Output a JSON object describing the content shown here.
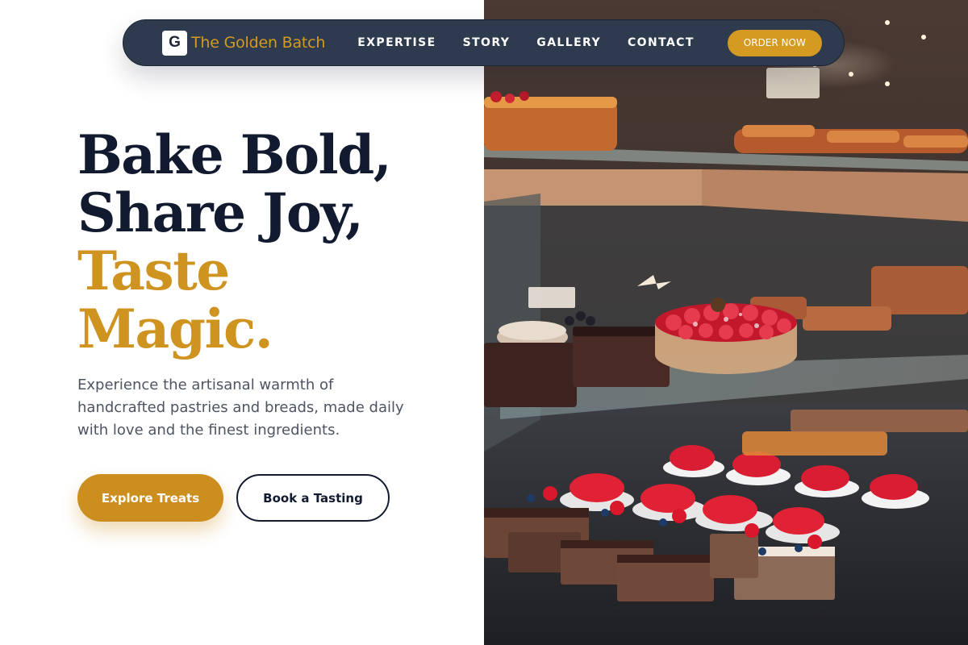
{
  "brand": {
    "mark": "G",
    "name": "The Golden Batch"
  },
  "nav": {
    "links": [
      "EXPERTISE",
      "STORY",
      "GALLERY",
      "CONTACT"
    ],
    "cta": "ORDER NOW"
  },
  "hero": {
    "title_lines": [
      "Bake Bold,",
      "Share Joy,"
    ],
    "title_accent_lines": [
      "Taste",
      "Magic."
    ],
    "description": "Experience the artisanal warmth of handcrafted pastries and breads, made daily with love and the finest ingredients.",
    "primary_button": "Explore Treats",
    "secondary_button": "Book a Tasting"
  },
  "image": {
    "subject": "bakery-display-case"
  },
  "colors": {
    "navy": "#111a2e",
    "nav_bg": "#2e3a4e",
    "gold": "#cf9320",
    "body_text": "#4d5462"
  }
}
